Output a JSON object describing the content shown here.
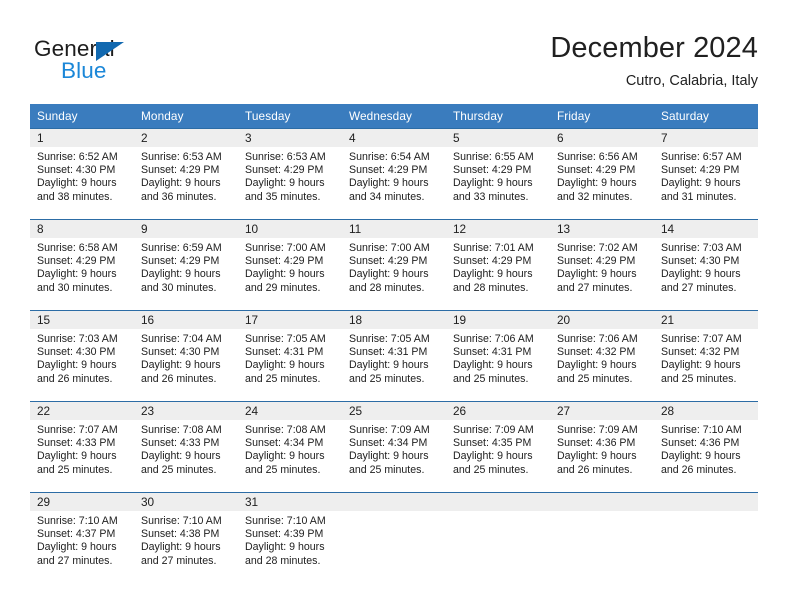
{
  "brand": {
    "name_part1": "General",
    "name_part2": "Blue",
    "triangle_color": "#1269b0",
    "blue_color": "#1b87d8"
  },
  "header": {
    "title": "December 2024",
    "subtitle": "Cutro, Calabria, Italy"
  },
  "colors": {
    "header_row_background": "#3a7cbe",
    "header_row_text": "#ffffff",
    "daynumber_band": "#eeeeee",
    "row_border": "#2c6ca5",
    "text": "#202020"
  },
  "weekday_headers": [
    "Sunday",
    "Monday",
    "Tuesday",
    "Wednesday",
    "Thursday",
    "Friday",
    "Saturday"
  ],
  "days": [
    {
      "date": "1",
      "sunrise": "Sunrise: 6:52 AM",
      "sunset": "Sunset: 4:30 PM",
      "daylight_line1": "Daylight: 9 hours",
      "daylight_line2": "and 38 minutes."
    },
    {
      "date": "2",
      "sunrise": "Sunrise: 6:53 AM",
      "sunset": "Sunset: 4:29 PM",
      "daylight_line1": "Daylight: 9 hours",
      "daylight_line2": "and 36 minutes."
    },
    {
      "date": "3",
      "sunrise": "Sunrise: 6:53 AM",
      "sunset": "Sunset: 4:29 PM",
      "daylight_line1": "Daylight: 9 hours",
      "daylight_line2": "and 35 minutes."
    },
    {
      "date": "4",
      "sunrise": "Sunrise: 6:54 AM",
      "sunset": "Sunset: 4:29 PM",
      "daylight_line1": "Daylight: 9 hours",
      "daylight_line2": "and 34 minutes."
    },
    {
      "date": "5",
      "sunrise": "Sunrise: 6:55 AM",
      "sunset": "Sunset: 4:29 PM",
      "daylight_line1": "Daylight: 9 hours",
      "daylight_line2": "and 33 minutes."
    },
    {
      "date": "6",
      "sunrise": "Sunrise: 6:56 AM",
      "sunset": "Sunset: 4:29 PM",
      "daylight_line1": "Daylight: 9 hours",
      "daylight_line2": "and 32 minutes."
    },
    {
      "date": "7",
      "sunrise": "Sunrise: 6:57 AM",
      "sunset": "Sunset: 4:29 PM",
      "daylight_line1": "Daylight: 9 hours",
      "daylight_line2": "and 31 minutes."
    },
    {
      "date": "8",
      "sunrise": "Sunrise: 6:58 AM",
      "sunset": "Sunset: 4:29 PM",
      "daylight_line1": "Daylight: 9 hours",
      "daylight_line2": "and 30 minutes."
    },
    {
      "date": "9",
      "sunrise": "Sunrise: 6:59 AM",
      "sunset": "Sunset: 4:29 PM",
      "daylight_line1": "Daylight: 9 hours",
      "daylight_line2": "and 30 minutes."
    },
    {
      "date": "10",
      "sunrise": "Sunrise: 7:00 AM",
      "sunset": "Sunset: 4:29 PM",
      "daylight_line1": "Daylight: 9 hours",
      "daylight_line2": "and 29 minutes."
    },
    {
      "date": "11",
      "sunrise": "Sunrise: 7:00 AM",
      "sunset": "Sunset: 4:29 PM",
      "daylight_line1": "Daylight: 9 hours",
      "daylight_line2": "and 28 minutes."
    },
    {
      "date": "12",
      "sunrise": "Sunrise: 7:01 AM",
      "sunset": "Sunset: 4:29 PM",
      "daylight_line1": "Daylight: 9 hours",
      "daylight_line2": "and 28 minutes."
    },
    {
      "date": "13",
      "sunrise": "Sunrise: 7:02 AM",
      "sunset": "Sunset: 4:29 PM",
      "daylight_line1": "Daylight: 9 hours",
      "daylight_line2": "and 27 minutes."
    },
    {
      "date": "14",
      "sunrise": "Sunrise: 7:03 AM",
      "sunset": "Sunset: 4:30 PM",
      "daylight_line1": "Daylight: 9 hours",
      "daylight_line2": "and 27 minutes."
    },
    {
      "date": "15",
      "sunrise": "Sunrise: 7:03 AM",
      "sunset": "Sunset: 4:30 PM",
      "daylight_line1": "Daylight: 9 hours",
      "daylight_line2": "and 26 minutes."
    },
    {
      "date": "16",
      "sunrise": "Sunrise: 7:04 AM",
      "sunset": "Sunset: 4:30 PM",
      "daylight_line1": "Daylight: 9 hours",
      "daylight_line2": "and 26 minutes."
    },
    {
      "date": "17",
      "sunrise": "Sunrise: 7:05 AM",
      "sunset": "Sunset: 4:31 PM",
      "daylight_line1": "Daylight: 9 hours",
      "daylight_line2": "and 25 minutes."
    },
    {
      "date": "18",
      "sunrise": "Sunrise: 7:05 AM",
      "sunset": "Sunset: 4:31 PM",
      "daylight_line1": "Daylight: 9 hours",
      "daylight_line2": "and 25 minutes."
    },
    {
      "date": "19",
      "sunrise": "Sunrise: 7:06 AM",
      "sunset": "Sunset: 4:31 PM",
      "daylight_line1": "Daylight: 9 hours",
      "daylight_line2": "and 25 minutes."
    },
    {
      "date": "20",
      "sunrise": "Sunrise: 7:06 AM",
      "sunset": "Sunset: 4:32 PM",
      "daylight_line1": "Daylight: 9 hours",
      "daylight_line2": "and 25 minutes."
    },
    {
      "date": "21",
      "sunrise": "Sunrise: 7:07 AM",
      "sunset": "Sunset: 4:32 PM",
      "daylight_line1": "Daylight: 9 hours",
      "daylight_line2": "and 25 minutes."
    },
    {
      "date": "22",
      "sunrise": "Sunrise: 7:07 AM",
      "sunset": "Sunset: 4:33 PM",
      "daylight_line1": "Daylight: 9 hours",
      "daylight_line2": "and 25 minutes."
    },
    {
      "date": "23",
      "sunrise": "Sunrise: 7:08 AM",
      "sunset": "Sunset: 4:33 PM",
      "daylight_line1": "Daylight: 9 hours",
      "daylight_line2": "and 25 minutes."
    },
    {
      "date": "24",
      "sunrise": "Sunrise: 7:08 AM",
      "sunset": "Sunset: 4:34 PM",
      "daylight_line1": "Daylight: 9 hours",
      "daylight_line2": "and 25 minutes."
    },
    {
      "date": "25",
      "sunrise": "Sunrise: 7:09 AM",
      "sunset": "Sunset: 4:34 PM",
      "daylight_line1": "Daylight: 9 hours",
      "daylight_line2": "and 25 minutes."
    },
    {
      "date": "26",
      "sunrise": "Sunrise: 7:09 AM",
      "sunset": "Sunset: 4:35 PM",
      "daylight_line1": "Daylight: 9 hours",
      "daylight_line2": "and 25 minutes."
    },
    {
      "date": "27",
      "sunrise": "Sunrise: 7:09 AM",
      "sunset": "Sunset: 4:36 PM",
      "daylight_line1": "Daylight: 9 hours",
      "daylight_line2": "and 26 minutes."
    },
    {
      "date": "28",
      "sunrise": "Sunrise: 7:10 AM",
      "sunset": "Sunset: 4:36 PM",
      "daylight_line1": "Daylight: 9 hours",
      "daylight_line2": "and 26 minutes."
    },
    {
      "date": "29",
      "sunrise": "Sunrise: 7:10 AM",
      "sunset": "Sunset: 4:37 PM",
      "daylight_line1": "Daylight: 9 hours",
      "daylight_line2": "and 27 minutes."
    },
    {
      "date": "30",
      "sunrise": "Sunrise: 7:10 AM",
      "sunset": "Sunset: 4:38 PM",
      "daylight_line1": "Daylight: 9 hours",
      "daylight_line2": "and 27 minutes."
    },
    {
      "date": "31",
      "sunrise": "Sunrise: 7:10 AM",
      "sunset": "Sunset: 4:39 PM",
      "daylight_line1": "Daylight: 9 hours",
      "daylight_line2": "and 28 minutes."
    }
  ]
}
